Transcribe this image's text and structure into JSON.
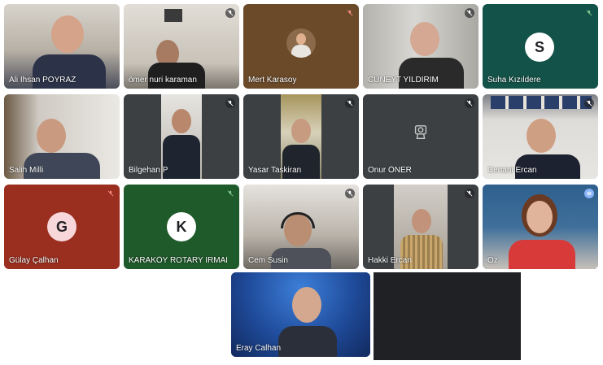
{
  "meeting": {
    "participants": [
      {
        "name": "Ali İhsan POYRAZ",
        "mic": "on"
      },
      {
        "name": "ömer nuri karaman",
        "mic": "muted"
      },
      {
        "name": "Mert Karasoy",
        "mic": "muted-red"
      },
      {
        "name": "CÜNEYT YILDIRIM",
        "mic": "muted"
      },
      {
        "name": "Suha Kızıldere",
        "mic": "muted-green",
        "avatar_letter": "S"
      },
      {
        "name": "Salih Milli",
        "mic": "on"
      },
      {
        "name": "Bilgehan P",
        "mic": "muted"
      },
      {
        "name": "Yasar Taskiran",
        "mic": "muted"
      },
      {
        "name": "Onur ÖNER",
        "mic": "muted"
      },
      {
        "name": "Cenani Ercan",
        "mic": "muted"
      },
      {
        "name": "Gülay Çalhan",
        "mic": "muted-red",
        "avatar_letter": "G"
      },
      {
        "name": "KARAKÖY ROTARY IRMAK",
        "mic": "muted-green",
        "avatar_letter": "K"
      },
      {
        "name": "Cem Susin",
        "mic": "muted"
      },
      {
        "name": "Hakki Ercan",
        "mic": "muted"
      },
      {
        "name": "Oz",
        "mic": "speaking"
      },
      {
        "name": "Eray Calhan",
        "mic": "on"
      }
    ],
    "colors": {
      "tile_bg": "#3c4043",
      "gulay_bg": "#9a2e1f",
      "karakoy_bg": "#1f5a2a",
      "suha_bg": "#135248",
      "mert_bg": "#6b4a2a",
      "speaking_blue": "#8ab4f8",
      "avatar_circle": "#f8d7da"
    },
    "icons": [
      "mic-off-icon",
      "camera-off-icon",
      "audio-wave-icon"
    ]
  }
}
